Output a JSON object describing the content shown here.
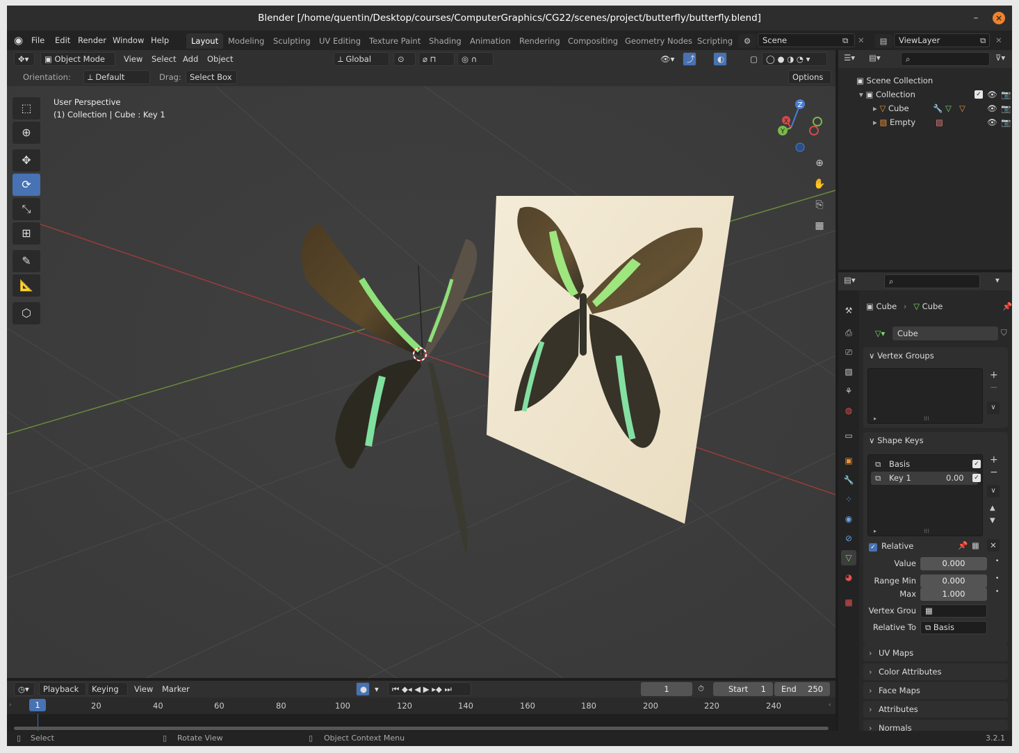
{
  "window": {
    "title": "Blender [/home/quentin/Desktop/courses/ComputerGraphics/CG22/scenes/project/butterfly/butterfly.blend]"
  },
  "menu": [
    "File",
    "Edit",
    "Render",
    "Window",
    "Help"
  ],
  "workspaces": [
    "Layout",
    "Modeling",
    "Sculpting",
    "UV Editing",
    "Texture Paint",
    "Shading",
    "Animation",
    "Rendering",
    "Compositing",
    "Geometry Nodes",
    "Scripting"
  ],
  "active_workspace": "Layout",
  "scene": {
    "name": "Scene"
  },
  "view_layer": {
    "name": "ViewLayer"
  },
  "viewport": {
    "mode": "Object Mode",
    "menus": [
      "View",
      "Select",
      "Add",
      "Object"
    ],
    "transform_orientation": "Global",
    "orientation_label": "Orientation:",
    "orientation_value": "Default",
    "drag_label": "Drag:",
    "drag_value": "Select Box",
    "options_label": "Options",
    "info_line1": "User Perspective",
    "info_line2": "(1) Collection | Cube : Key 1",
    "gizmo_axes": {
      "x": "X",
      "y": "Y",
      "z": "Z"
    }
  },
  "outliner": {
    "rows": [
      {
        "label": "Scene Collection"
      },
      {
        "label": "Collection"
      },
      {
        "label": "Cube"
      },
      {
        "label": "Empty"
      }
    ]
  },
  "properties": {
    "breadcrumb_object": "Cube",
    "breadcrumb_data": "Cube",
    "data_name": "Cube",
    "vertex_groups": {
      "title": "Vertex Groups"
    },
    "shape_keys": {
      "title": "Shape Keys",
      "keys": [
        {
          "name": "Basis",
          "value": ""
        },
        {
          "name": "Key 1",
          "value": "0.00"
        }
      ],
      "relative_label": "Relative",
      "value_label": "Value",
      "value": "0.000",
      "range_min_label": "Range Min",
      "range_min": "0.000",
      "max_label": "Max",
      "max": "1.000",
      "vertex_group_label": "Vertex Grou",
      "relative_to_label": "Relative To",
      "relative_to": "Basis"
    },
    "collapsed_panels": [
      "UV Maps",
      "Color Attributes",
      "Face Maps",
      "Attributes",
      "Normals"
    ]
  },
  "timeline": {
    "menus": [
      "Playback",
      "Keying",
      "View",
      "Marker"
    ],
    "current_frame": "1",
    "start_label": "Start",
    "start": "1",
    "end_label": "End",
    "end": "250",
    "ticks": [
      "20",
      "40",
      "60",
      "80",
      "100",
      "120",
      "140",
      "160",
      "180",
      "200",
      "220",
      "240"
    ],
    "playhead": "1"
  },
  "statusbar": {
    "items": [
      "Select",
      "Rotate View",
      "Object Context Menu"
    ],
    "version": "3.2.1"
  },
  "colors": {
    "accent": "#4772b3",
    "x_axis": "#d44a4a",
    "y_axis": "#7ab84a",
    "z_axis": "#4a7fd4",
    "close": "#f0822e"
  }
}
